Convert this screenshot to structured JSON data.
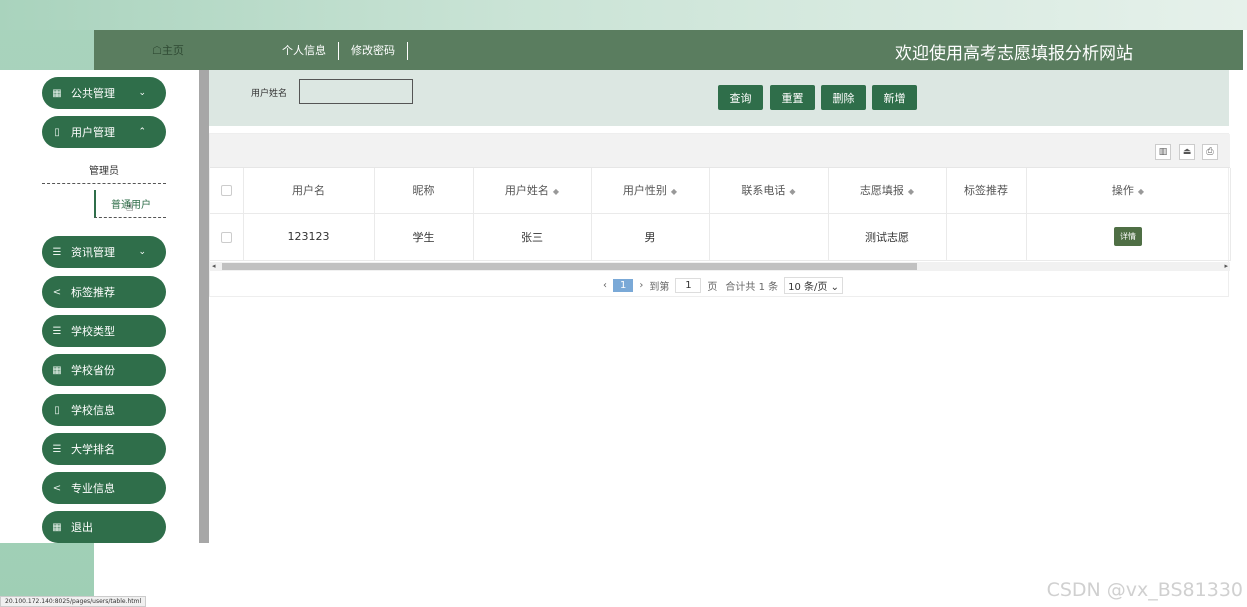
{
  "header": {
    "home": "☖主页",
    "nav": [
      "个人信息",
      "修改密码"
    ],
    "title": "欢迎使用高考志愿填报分析网站"
  },
  "sidebar": {
    "items": [
      {
        "label": "公共管理",
        "icon": "grid-icon",
        "chevron": "⌄"
      },
      {
        "label": "用户管理",
        "icon": "book-icon",
        "chevron": "⌃"
      },
      {
        "label": "资讯管理",
        "icon": "list-icon",
        "chevron": "⌄"
      },
      {
        "label": "标签推荐",
        "icon": "share-icon"
      },
      {
        "label": "学校类型",
        "icon": "list-icon"
      },
      {
        "label": "学校省份",
        "icon": "grid-icon"
      },
      {
        "label": "学校信息",
        "icon": "book-icon"
      },
      {
        "label": "大学排名",
        "icon": "list-icon"
      },
      {
        "label": "专业信息",
        "icon": "share-icon"
      },
      {
        "label": "退出",
        "icon": "grid-icon"
      }
    ],
    "sub_items": [
      "管理员",
      "普通用户"
    ]
  },
  "search": {
    "label": "用户姓名",
    "value": "",
    "buttons": [
      "查询",
      "重置",
      "删除",
      "新增"
    ]
  },
  "table": {
    "columns": [
      "用户名",
      "昵称",
      "用户姓名",
      "用户性别",
      "联系电话",
      "志愿填报",
      "标签推荐",
      "操作"
    ],
    "rows": [
      {
        "username": "123123",
        "nickname": "学生",
        "realname": "张三",
        "gender": "男",
        "phone": "",
        "volunteer": "测试志愿",
        "tags": "",
        "action": "详情"
      }
    ]
  },
  "pager": {
    "current": "1",
    "goto_label": "到第",
    "goto_value": "1",
    "page_label": "页",
    "total": "合计共 1 条",
    "page_size": "10 条/页 ⌄"
  },
  "watermark": "CSDN @vx_BS81330",
  "status_url": "20.100.172.140:8025/pages/users/table.html",
  "colors": {
    "primary": "#2f6e4a",
    "header": "#5a7d5f",
    "accent": "#7aa9d7"
  }
}
